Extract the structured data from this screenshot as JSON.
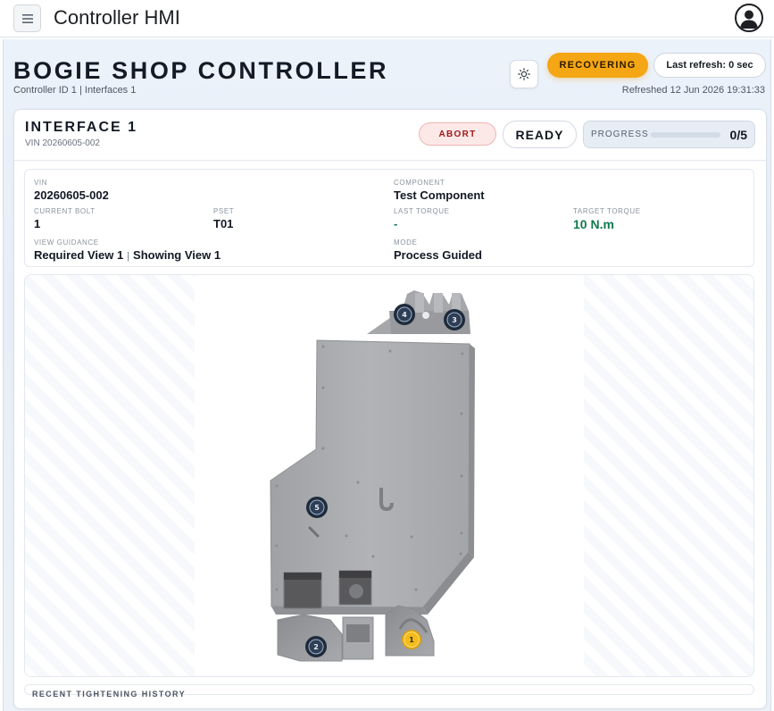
{
  "app": {
    "title": "Controller HMI",
    "menu_icon": "hamburger-icon",
    "profile_icon": "user-avatar-icon"
  },
  "controller": {
    "title": "BOGIE SHOP CONTROLLER",
    "subtitle": "Controller ID 1 | Interfaces 1",
    "theme_icon": "sun-icon",
    "status": "RECOVERING",
    "status_color": "#f5a614",
    "last_refresh": "Last refresh: 0 sec",
    "refreshed_at": "Refreshed 12 Jun 2026 19:31:33"
  },
  "interface": {
    "title": "INTERFACE 1",
    "vin_line": "VIN 20260605-002",
    "abort_label": "ABORT",
    "ready_label": "READY",
    "progress_label": "PROGRESS",
    "progress_text": "0/5",
    "progress_fraction": 0
  },
  "details": {
    "vin_label": "VIN",
    "vin": "20260605-002",
    "component_label": "COMPONENT",
    "component": "Test Component",
    "current_bolt_label": "CURRENT BOLT",
    "current_bolt": "1",
    "pset_label": "PSET",
    "pset": "T01",
    "last_torque_label": "LAST TORQUE",
    "last_torque": "-",
    "target_torque_label": "TARGET TORQUE",
    "target_torque": "10 N.m",
    "view_guidance_label": "VIEW GUIDANCE",
    "required_view": "Required View 1",
    "separator": "|",
    "showing_view": "Showing View 1",
    "mode_label": "MODE",
    "mode": "Process Guided"
  },
  "viewer": {
    "bolts": [
      {
        "label": "1",
        "state": "active"
      },
      {
        "label": "2",
        "state": "pending"
      },
      {
        "label": "3",
        "state": "pending"
      },
      {
        "label": "4",
        "state": "pending"
      },
      {
        "label": "5",
        "state": "pending"
      }
    ],
    "active_color": "#f2bc1c",
    "pending_color": "#2e3e55"
  },
  "history": {
    "label": "RECENT TIGHTENING HISTORY"
  }
}
